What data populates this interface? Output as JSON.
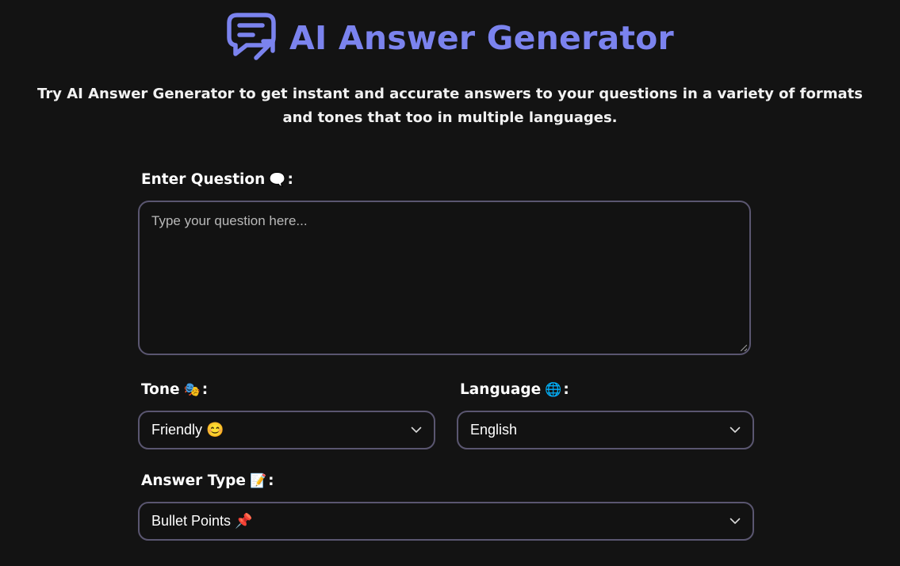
{
  "header": {
    "title": "AI Answer Generator",
    "subtitle": "Try AI Answer Generator to get instant and accurate answers to your questions in a variety of formats and tones that too in multiple languages.",
    "logo_icon": "chat-bubble-share-icon",
    "accent_color": "#7b83ee"
  },
  "question": {
    "label": "Enter Question",
    "emoji": "🗨️",
    "placeholder": "Type your question here..."
  },
  "tone": {
    "label": "Tone",
    "emoji": "🎭",
    "selected": "Friendly 😊"
  },
  "language": {
    "label": "Language",
    "emoji": "🌐",
    "selected": "English"
  },
  "answer_type": {
    "label": "Answer Type",
    "emoji": "📝",
    "selected": "Bullet Points 📌"
  },
  "colors": {
    "background": "#131313",
    "field_border": "#5a5670"
  }
}
